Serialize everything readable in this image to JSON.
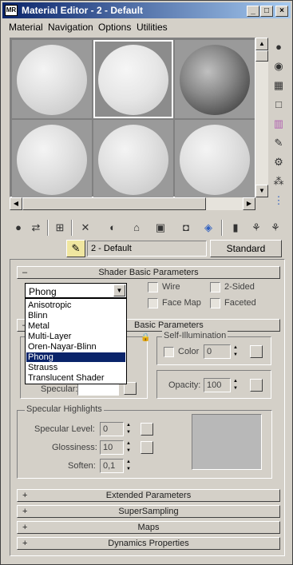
{
  "window": {
    "title": "Material Editor - 2 - Default",
    "app_icon_text": "MR"
  },
  "titlebar_buttons": {
    "minimize": "_",
    "maximize": "□",
    "close": "×"
  },
  "menu": [
    "Material",
    "Navigation",
    "Options",
    "Utilities"
  ],
  "toolbar_icons": [
    "get-material-icon",
    "put-to-scene-icon",
    "assign-to-selection-icon",
    "reset-icon",
    "make-unique-icon",
    "put-to-library-icon",
    "material-id-icon",
    "show-map-icon",
    "show-end-result-icon",
    "go-to-parent-icon",
    "go-forward-icon"
  ],
  "side_icons": [
    "sample-type-icon",
    "backlight-icon",
    "background-icon",
    "uv-tiling-icon",
    "video-color-check-icon",
    "make-preview-icon",
    "options-icon",
    "select-by-material-icon",
    "material-navigator-icon"
  ],
  "material_name": "2 - Default",
  "material_type": "Standard",
  "rollouts": {
    "shader_basic": {
      "sign": "–",
      "title": "Shader Basic Parameters"
    },
    "basic_params": {
      "sign": "–",
      "title": "Basic Parameters"
    },
    "extended": {
      "sign": "+",
      "title": "Extended Parameters"
    },
    "supersampling": {
      "sign": "+",
      "title": "SuperSampling"
    },
    "maps": {
      "sign": "+",
      "title": "Maps"
    },
    "dynamics": {
      "sign": "+",
      "title": "Dynamics Properties"
    }
  },
  "shader": {
    "selected": "Phong",
    "options": [
      "Anisotropic",
      "Blinn",
      "Metal",
      "Multi-Layer",
      "Oren-Nayar-Blinn",
      "Phong",
      "Strauss",
      "Translucent Shader"
    ],
    "highlighted_index": 5
  },
  "checkboxes": {
    "wire": "Wire",
    "two_sided": "2-Sided",
    "face_map": "Face Map",
    "faceted": "Faceted"
  },
  "self_illumination": {
    "label": "Self-Illumination",
    "color_label": "Color",
    "value": "0"
  },
  "opacity": {
    "label": "Opacity:",
    "value": "100"
  },
  "specular_label": "Specular:",
  "specular_highlights": {
    "label": "Specular Highlights",
    "level_label": "Specular Level:",
    "level": "0",
    "gloss_label": "Glossiness:",
    "gloss": "10",
    "soften_label": "Soften:",
    "soften": "0,1"
  }
}
